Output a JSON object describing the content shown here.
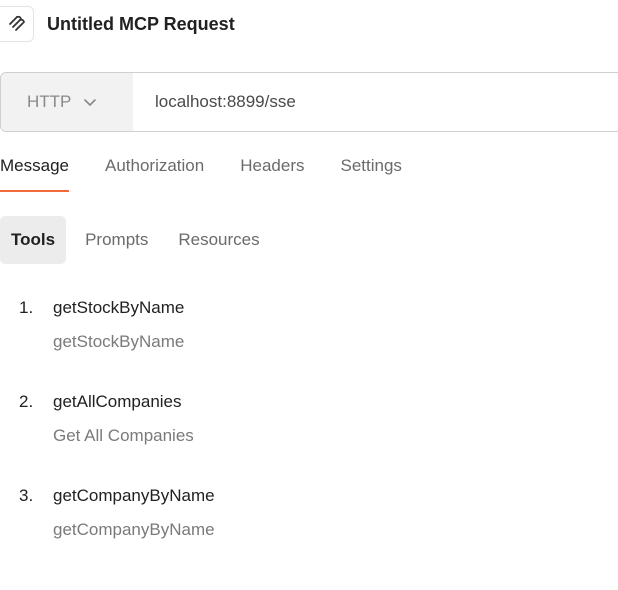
{
  "header": {
    "title": "Untitled MCP Request",
    "icon": "mcp-request-icon"
  },
  "urlbar": {
    "method": "HTTP",
    "url": "localhost:8899/sse"
  },
  "tabs": [
    {
      "label": "Message",
      "active": true
    },
    {
      "label": "Authorization",
      "active": false
    },
    {
      "label": "Headers",
      "active": false
    },
    {
      "label": "Settings",
      "active": false
    }
  ],
  "subtabs": [
    {
      "label": "Tools",
      "active": true
    },
    {
      "label": "Prompts",
      "active": false
    },
    {
      "label": "Resources",
      "active": false
    }
  ],
  "tools": [
    {
      "num": "1.",
      "name": "getStockByName",
      "desc": "getStockByName"
    },
    {
      "num": "2.",
      "name": "getAllCompanies",
      "desc": "Get All Companies"
    },
    {
      "num": "3.",
      "name": "getCompanyByName",
      "desc": "getCompanyByName"
    }
  ],
  "colors": {
    "accent": "#f26b3a",
    "active_subtab_bg": "#ececec",
    "method_bg": "#f2f2f2"
  }
}
